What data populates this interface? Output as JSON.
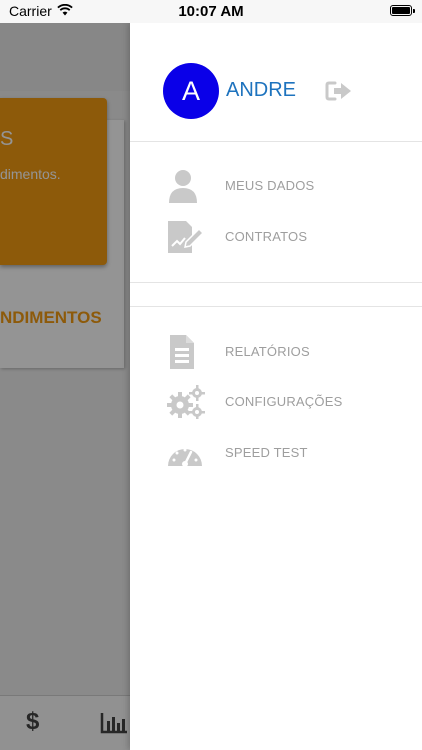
{
  "status_bar": {
    "carrier": "Carrier",
    "time": "10:07 AM"
  },
  "background": {
    "card_title": "S",
    "card_subtitle": "dimentos.",
    "card_link": "NDIMENTOS"
  },
  "drawer": {
    "avatar_letter": "A",
    "user_name": "ANDRE",
    "menu_primary": [
      {
        "label": "MEUS DADOS",
        "icon": "user-icon"
      },
      {
        "label": "CONTRATOS",
        "icon": "contract-edit-icon"
      }
    ],
    "menu_secondary": [
      {
        "label": "RELATÓRIOS",
        "icon": "report-icon"
      },
      {
        "label": "CONFIGURAÇÕES",
        "icon": "gears-icon"
      },
      {
        "label": "SPEED TEST",
        "icon": "speedometer-icon"
      }
    ]
  },
  "colors": {
    "avatar": "#0a00e8",
    "name": "#1e73be",
    "accent": "#f39c12",
    "icon_gray": "#c9c9c9"
  }
}
